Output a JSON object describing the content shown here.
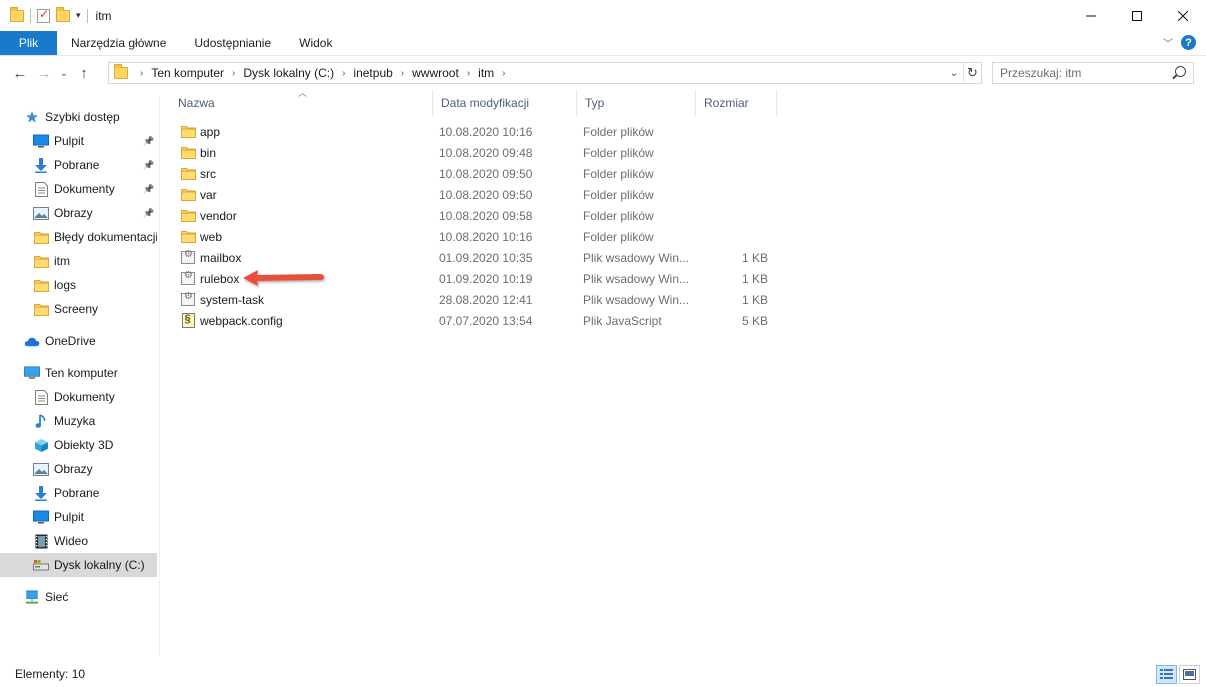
{
  "window": {
    "title": "itm"
  },
  "ribbon": {
    "tabs": [
      "Plik",
      "Narzędzia główne",
      "Udostępnianie",
      "Widok"
    ]
  },
  "address": {
    "crumbs": [
      "Ten komputer",
      "Dysk lokalny (C:)",
      "inetpub",
      "wwwroot",
      "itm"
    ]
  },
  "search": {
    "placeholder": "Przeszukaj: itm"
  },
  "sidebar": {
    "items": [
      {
        "label": "Szybki dostęp",
        "icon": "star-icon",
        "level": 0,
        "pinned": false
      },
      {
        "label": "Pulpit",
        "icon": "desktop-icon",
        "level": 1,
        "pinned": true
      },
      {
        "label": "Pobrane",
        "icon": "download-icon",
        "level": 1,
        "pinned": true
      },
      {
        "label": "Dokumenty",
        "icon": "document-icon",
        "level": 1,
        "pinned": true
      },
      {
        "label": "Obrazy",
        "icon": "picture-icon",
        "level": 1,
        "pinned": true
      },
      {
        "label": "Błędy dokumentacji",
        "icon": "folder-icon",
        "level": 1,
        "pinned": false
      },
      {
        "label": "itm",
        "icon": "folder-icon",
        "level": 1,
        "pinned": false
      },
      {
        "label": "logs",
        "icon": "folder-icon",
        "level": 1,
        "pinned": false
      },
      {
        "label": "Screeny",
        "icon": "folder-icon",
        "level": 1,
        "pinned": false
      },
      {
        "label": "OneDrive",
        "icon": "cloud-icon",
        "level": 0,
        "pinned": false
      },
      {
        "label": "Ten komputer",
        "icon": "computer-icon",
        "level": 0,
        "pinned": false
      },
      {
        "label": "Dokumenty",
        "icon": "document-icon",
        "level": 1,
        "pinned": false
      },
      {
        "label": "Muzyka",
        "icon": "music-icon",
        "level": 1,
        "pinned": false
      },
      {
        "label": "Obiekty 3D",
        "icon": "cube-icon",
        "level": 1,
        "pinned": false
      },
      {
        "label": "Obrazy",
        "icon": "picture-icon",
        "level": 1,
        "pinned": false
      },
      {
        "label": "Pobrane",
        "icon": "download-icon",
        "level": 1,
        "pinned": false
      },
      {
        "label": "Pulpit",
        "icon": "desktop-icon",
        "level": 1,
        "pinned": false
      },
      {
        "label": "Wideo",
        "icon": "video-icon",
        "level": 1,
        "pinned": false
      },
      {
        "label": "Dysk lokalny (C:)",
        "icon": "drive-icon",
        "level": 1,
        "pinned": false,
        "selected": true
      },
      {
        "label": "Sieć",
        "icon": "network-icon",
        "level": 0,
        "pinned": false
      }
    ]
  },
  "columns": [
    "Nazwa",
    "Data modyfikacji",
    "Typ",
    "Rozmiar"
  ],
  "files": [
    {
      "name": "app",
      "date": "10.08.2020 10:16",
      "type": "Folder plików",
      "size": "",
      "icon": "folder-icon"
    },
    {
      "name": "bin",
      "date": "10.08.2020 09:48",
      "type": "Folder plików",
      "size": "",
      "icon": "folder-icon"
    },
    {
      "name": "src",
      "date": "10.08.2020 09:50",
      "type": "Folder plików",
      "size": "",
      "icon": "folder-icon"
    },
    {
      "name": "var",
      "date": "10.08.2020 09:50",
      "type": "Folder plików",
      "size": "",
      "icon": "folder-icon"
    },
    {
      "name": "vendor",
      "date": "10.08.2020 09:58",
      "type": "Folder plików",
      "size": "",
      "icon": "folder-icon"
    },
    {
      "name": "web",
      "date": "10.08.2020 10:16",
      "type": "Folder plików",
      "size": "",
      "icon": "folder-icon"
    },
    {
      "name": "mailbox",
      "date": "01.09.2020 10:35",
      "type": "Plik wsadowy Win...",
      "size": "1 KB",
      "icon": "batch-file-icon"
    },
    {
      "name": "rulebox",
      "date": "01.09.2020 10:19",
      "type": "Plik wsadowy Win...",
      "size": "1 KB",
      "icon": "batch-file-icon"
    },
    {
      "name": "system-task",
      "date": "28.08.2020 12:41",
      "type": "Plik wsadowy Win...",
      "size": "1 KB",
      "icon": "batch-file-icon"
    },
    {
      "name": "webpack.config",
      "date": "07.07.2020 13:54",
      "type": "Plik JavaScript",
      "size": "5 KB",
      "icon": "javascript-file-icon"
    }
  ],
  "status": {
    "text": "Elementy: 10"
  },
  "colors": {
    "accent": "#1979ca",
    "arrow": "#e8503a"
  }
}
